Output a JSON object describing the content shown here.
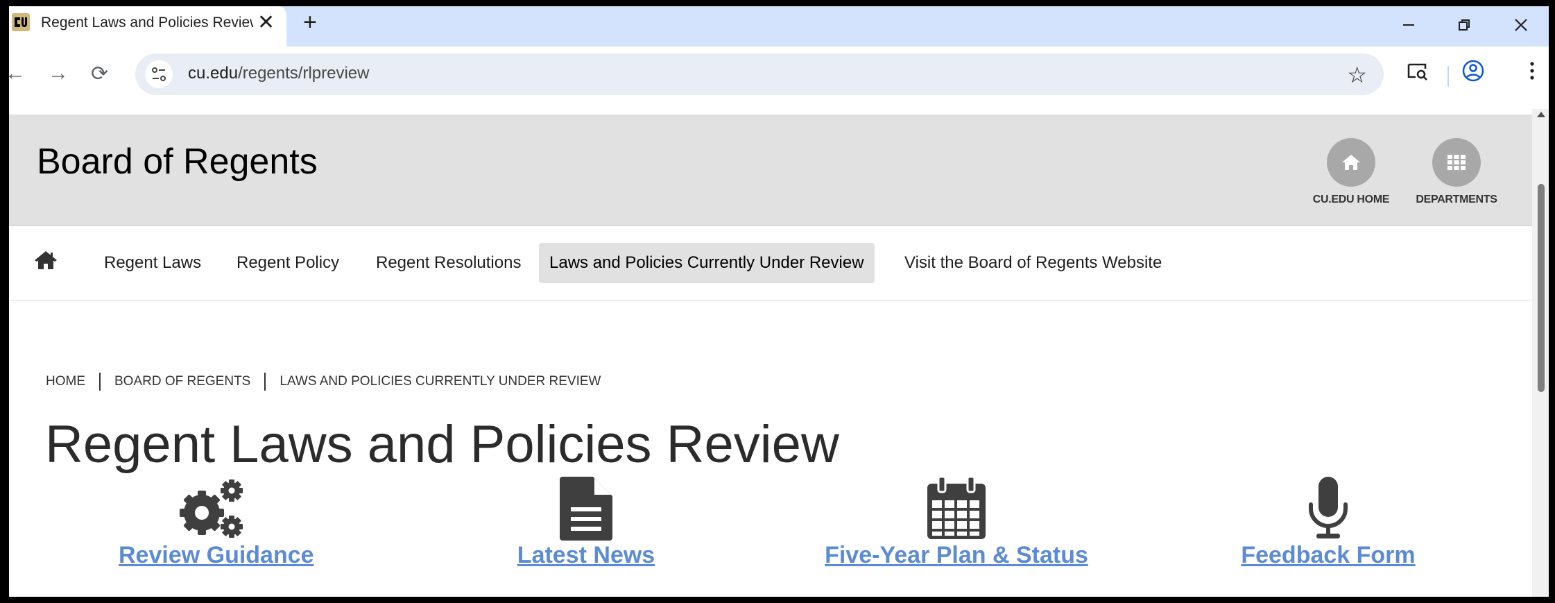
{
  "browser": {
    "tab_title": "Regent Laws and Policies Review",
    "close_tab_glyph": "✕",
    "new_tab_glyph": "+",
    "url_domain": "cu.edu",
    "url_path": "/regents/rlpreview",
    "back_glyph": "←",
    "forward_glyph": "→",
    "reload_glyph": "⟳",
    "star_glyph": "☆"
  },
  "header": {
    "site_title": "Board of Regents",
    "buttons": [
      {
        "label": "CU.EDU HOME",
        "icon": "home-icon"
      },
      {
        "label": "DEPARTMENTS",
        "icon": "grid-icon"
      }
    ]
  },
  "nav": {
    "items": [
      {
        "label": "Regent Laws"
      },
      {
        "label": "Regent Policy"
      },
      {
        "label": "Regent Resolutions"
      },
      {
        "label": "Laws and Policies Currently Under Review",
        "active": true
      },
      {
        "label": "Visit the Board of Regents Website"
      }
    ]
  },
  "breadcrumb": [
    "HOME",
    "BOARD OF REGENTS",
    "LAWS AND POLICIES CURRENTLY UNDER REVIEW"
  ],
  "page": {
    "title": "Regent Laws and Policies Review"
  },
  "features": [
    {
      "label": "Review Guidance",
      "icon": "gears-icon"
    },
    {
      "label": "Latest News",
      "icon": "document-icon"
    },
    {
      "label": "Five-Year Plan & Status",
      "icon": "calendar-icon"
    },
    {
      "label": "Feedback Form",
      "icon": "microphone-icon"
    }
  ],
  "colors": {
    "link": "#5b8bd5",
    "header_bg": "#e1e1e1",
    "tabstrip_bg": "#d3e3fd"
  }
}
